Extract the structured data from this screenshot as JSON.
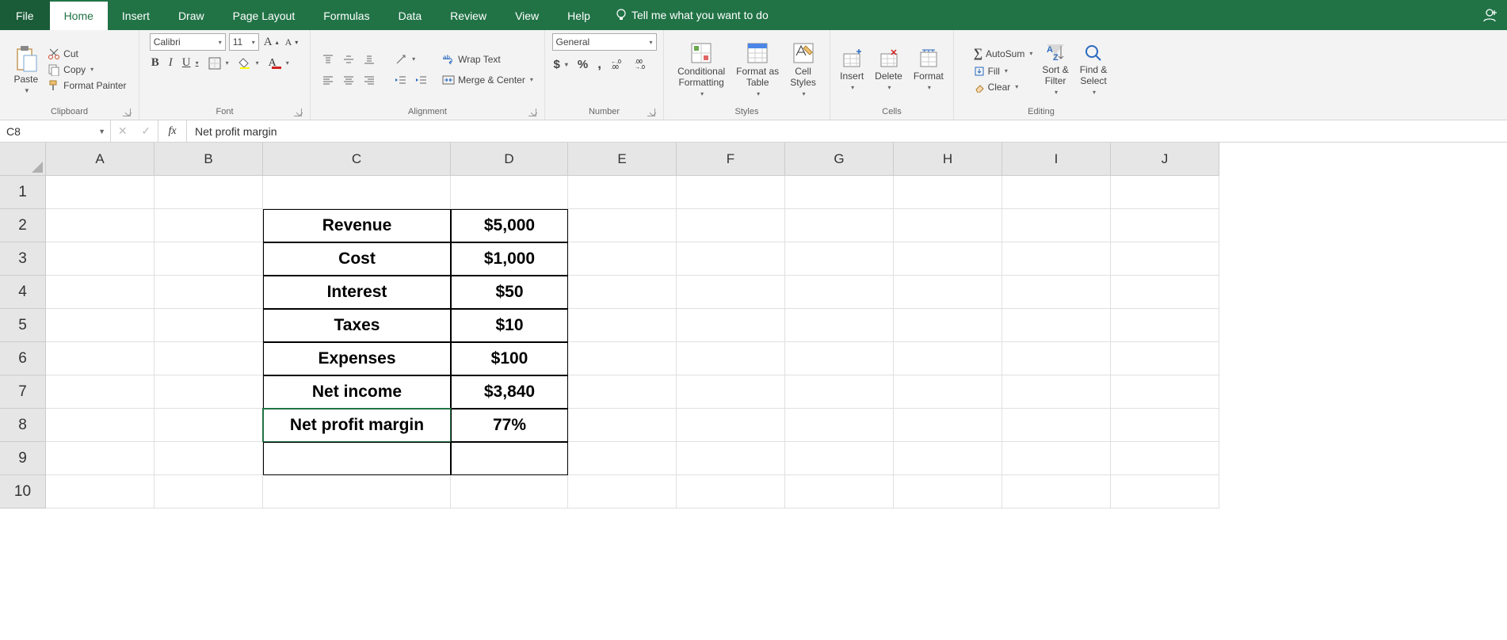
{
  "tabs": {
    "file": "File",
    "home": "Home",
    "insert": "Insert",
    "draw": "Draw",
    "page_layout": "Page Layout",
    "formulas": "Formulas",
    "data": "Data",
    "review": "Review",
    "view": "View",
    "help": "Help",
    "tellme": "Tell me what you want to do"
  },
  "clipboard": {
    "cut": "Cut",
    "copy": "Copy",
    "format_painter": "Format Painter",
    "paste": "Paste",
    "label": "Clipboard"
  },
  "font": {
    "name": "Calibri",
    "size": "11",
    "label": "Font"
  },
  "alignment": {
    "wrap": "Wrap Text",
    "merge": "Merge & Center",
    "label": "Alignment"
  },
  "number": {
    "format": "General",
    "label": "Number"
  },
  "styles": {
    "cond": "Conditional\nFormatting",
    "table": "Format as\nTable",
    "cell": "Cell\nStyles",
    "label": "Styles"
  },
  "cellsgrp": {
    "insert": "Insert",
    "delete": "Delete",
    "format": "Format",
    "label": "Cells"
  },
  "editing": {
    "autosum": "AutoSum",
    "fill": "Fill",
    "clear": "Clear",
    "sort": "Sort &\nFilter",
    "find": "Find &\nSelect",
    "label": "Editing"
  },
  "namebox": "C8",
  "fx": "fx",
  "formula": "Net profit margin",
  "columns": [
    "A",
    "B",
    "C",
    "D",
    "E",
    "F",
    "G",
    "H",
    "I",
    "J"
  ],
  "rows": [
    "1",
    "2",
    "3",
    "4",
    "5",
    "6",
    "7",
    "8",
    "9",
    "10"
  ],
  "data_table": {
    "C2": "Revenue",
    "D2": "$5,000",
    "C3": "Cost",
    "D3": "$1,000",
    "C4": "Interest",
    "D4": "$50",
    "C5": "Taxes",
    "D5": "$10",
    "C6": "Expenses",
    "D6": "$100",
    "C7": "Net income",
    "D7": "$3,840",
    "C8": "Net profit margin",
    "D8": "77%"
  }
}
